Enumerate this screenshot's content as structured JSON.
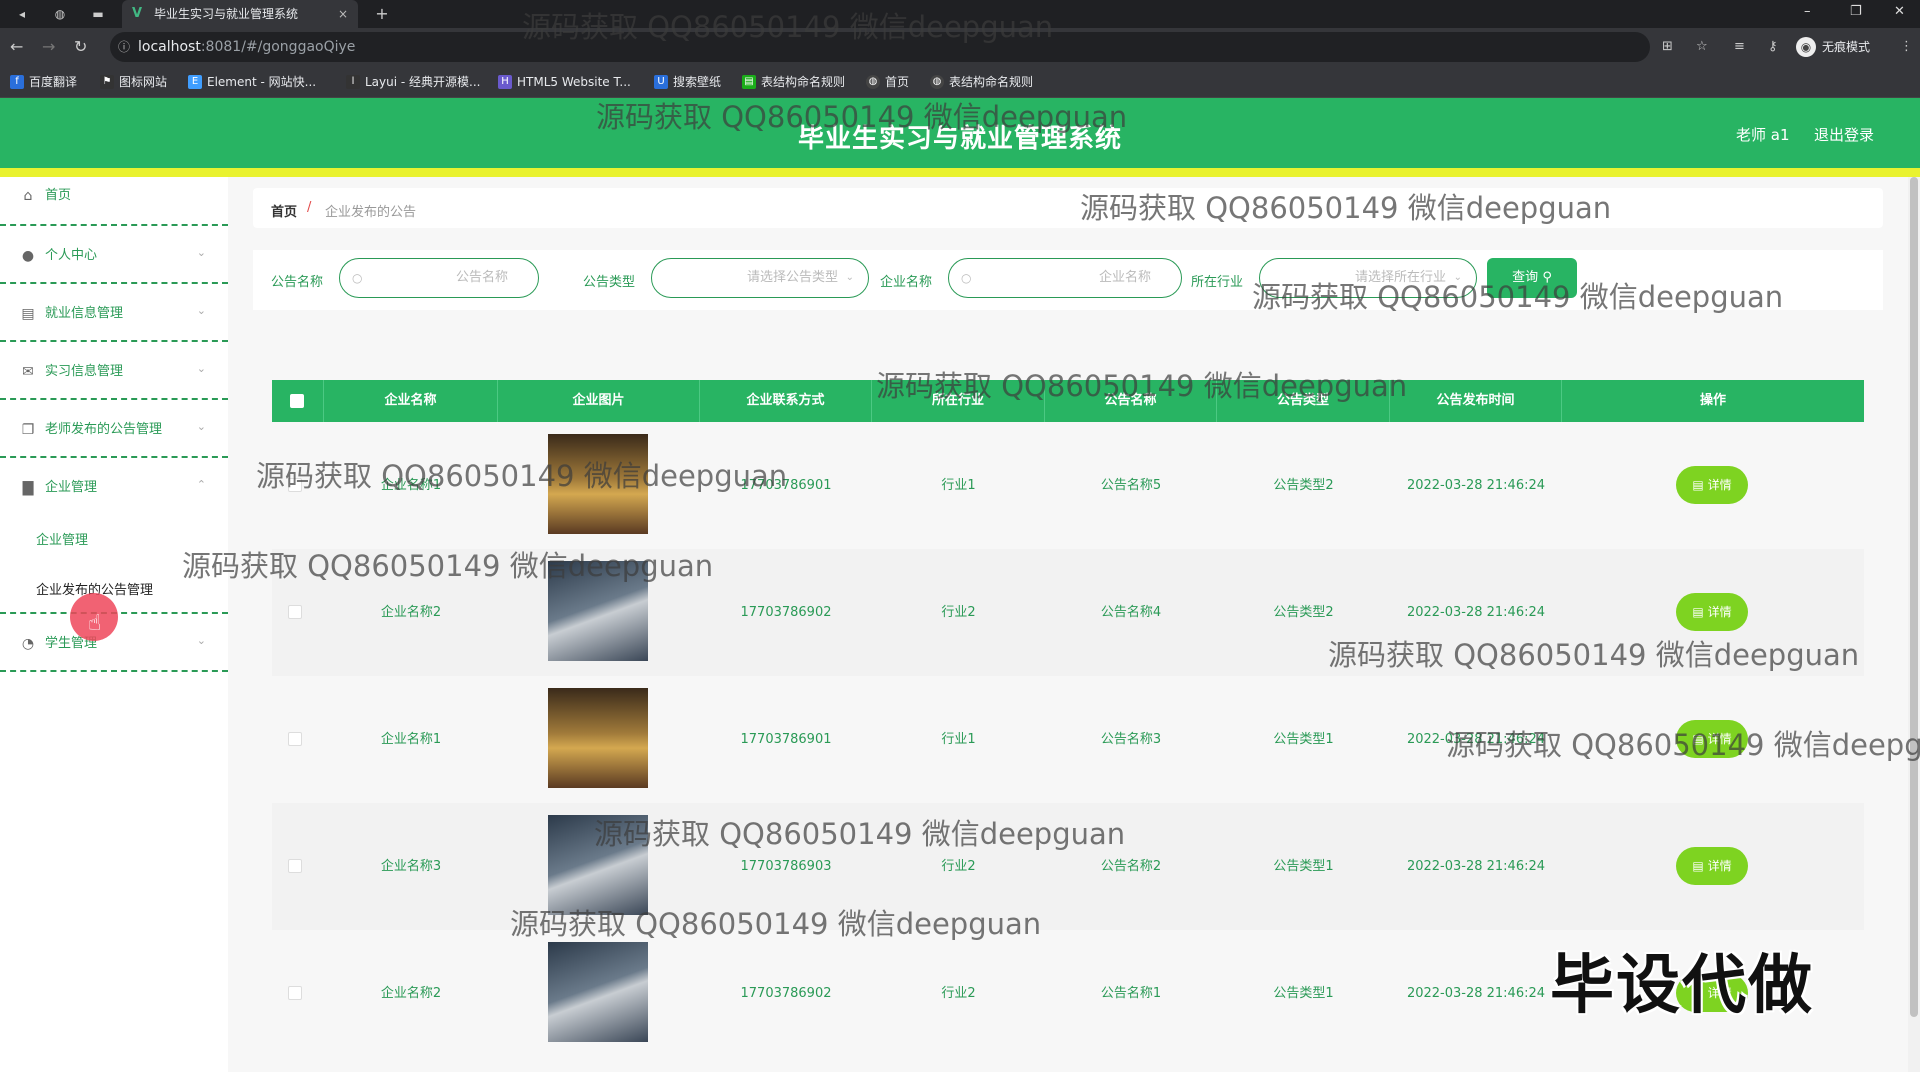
{
  "browser": {
    "tab_title": "毕业生实习与就业管理系统",
    "tab_close": "×",
    "new_tab": "+",
    "url_host": "localhost",
    "url_path": ":8081/#/gonggaoQiye",
    "profile": "无痕模式",
    "bookmarks": [
      "百度翻译",
      "图标网站",
      "Element - 网站快...",
      "Layui - 经典开源模...",
      "HTML5 Website T...",
      "搜索壁纸",
      "表结构命名规则",
      "首页",
      "表结构命名规则"
    ]
  },
  "header": {
    "title": "毕业生实习与就业管理系统",
    "user": "老师 a1",
    "logout": "退出登录"
  },
  "sidebar": {
    "items": [
      {
        "label": "首页",
        "icon": "home-icon"
      },
      {
        "label": "个人中心",
        "icon": "user-icon"
      },
      {
        "label": "就业信息管理",
        "icon": "clipboard-icon"
      },
      {
        "label": "实习信息管理",
        "icon": "mail-icon"
      },
      {
        "label": "老师发布的公告管理",
        "icon": "copy-icon"
      },
      {
        "label": "企业管理",
        "icon": "briefcase-icon"
      },
      {
        "label": "学生管理",
        "icon": "gauge-icon"
      }
    ],
    "subitems": [
      "企业管理",
      "企业发布的公告管理"
    ]
  },
  "breadcrumb": {
    "home": "首页",
    "sep": "/",
    "current": "企业发布的公告"
  },
  "search": {
    "name_label": "公告名称",
    "name_placeholder": "公告名称",
    "type_label": "公告类型",
    "type_placeholder": "请选择公告类型",
    "company_label": "企业名称",
    "company_placeholder": "企业名称",
    "industry_label": "所在行业",
    "industry_placeholder": "请选择所在行业",
    "query_button": "查询"
  },
  "table": {
    "columns": [
      "企业名称",
      "企业图片",
      "企业联系方式",
      "所在行业",
      "公告名称",
      "公告类型",
      "公告发布时间",
      "操作"
    ],
    "detail_label": "详情",
    "rows": [
      {
        "company": "企业名称1",
        "phone": "17703786901",
        "industry": "行业1",
        "notice": "公告名称5",
        "type": "公告类型2",
        "time": "2022-03-28 21:46:24"
      },
      {
        "company": "企业名称2",
        "phone": "17703786902",
        "industry": "行业2",
        "notice": "公告名称4",
        "type": "公告类型2",
        "time": "2022-03-28 21:46:24"
      },
      {
        "company": "企业名称1",
        "phone": "17703786901",
        "industry": "行业1",
        "notice": "公告名称3",
        "type": "公告类型1",
        "time": "2022-03-28 21:46:24"
      },
      {
        "company": "企业名称3",
        "phone": "17703786903",
        "industry": "行业2",
        "notice": "公告名称2",
        "type": "公告类型1",
        "time": "2022-03-28 21:46:24"
      },
      {
        "company": "企业名称2",
        "phone": "17703786902",
        "industry": "行业2",
        "notice": "公告名称1",
        "type": "公告类型1",
        "time": "2022-03-28 21:46:24"
      }
    ]
  },
  "watermarks": {
    "text": "源码获取 QQ86050149 微信deepguan",
    "big": "毕设代做"
  },
  "colors": {
    "primary": "#28b463",
    "accent_yellow": "#e9f22f",
    "detail_button": "#7ed321"
  }
}
